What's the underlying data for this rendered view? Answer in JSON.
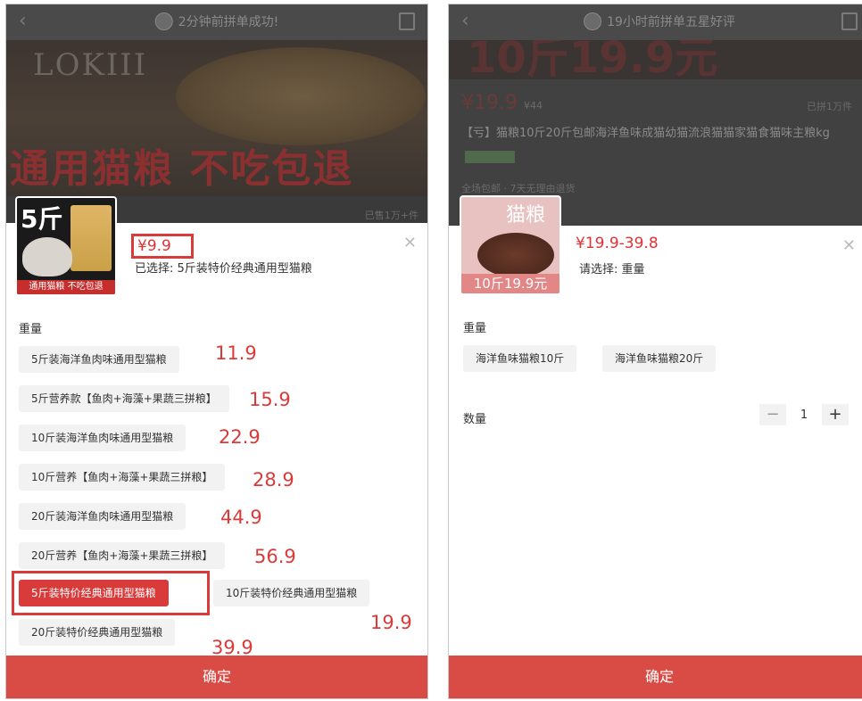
{
  "left": {
    "nav": {
      "back_icon": "‹",
      "notice": "2分钟前拼单成功!"
    },
    "banner": {
      "logo": "LOKIII",
      "slogan": "通用猫粮 不吃包退"
    },
    "sold_count": "已售1万+件",
    "thumb": {
      "size_text": "5斤",
      "ribbon": "通用猫粮 不吃包退"
    },
    "price": "¥9.9",
    "selected": "已选择: 5斤装特价经典通用型猫粮",
    "close_icon": "✕",
    "weight_label": "重量",
    "options": [
      {
        "label": "5斤装海洋鱼肉味通用型猫粮",
        "annot": "11.9"
      },
      {
        "label": "5斤营养款【鱼肉+海藻+果蔬三拼粮】",
        "annot": "15.9"
      },
      {
        "label": "10斤装海洋鱼肉味通用型猫粮",
        "annot": "22.9"
      },
      {
        "label": "10斤营养【鱼肉+海藻+果蔬三拼粮】",
        "annot": "28.9"
      },
      {
        "label": "20斤装海洋鱼肉味通用型猫粮",
        "annot": "44.9"
      },
      {
        "label": "20斤营养【鱼肉+海藻+果蔬三拼粮】",
        "annot": "56.9"
      },
      {
        "label": "5斤装特价经典通用型猫粮",
        "active": true
      },
      {
        "label": "10斤装特价经典通用型猫粮",
        "annot": "19.9"
      },
      {
        "label": "20斤装特价经典通用型猫粮",
        "annot": "39.9"
      }
    ],
    "confirm": "确定"
  },
  "right": {
    "nav": {
      "back_icon": "‹",
      "notice": "19小时前拼单五星好评"
    },
    "info": {
      "big_strip": "10斤19.9元",
      "price": "¥19.9",
      "price_old": "¥44",
      "ship": "已拼1万件",
      "title": "【亏】猫粮10斤20斤包邮海洋鱼味成猫幼猫流浪猫猫家猫食猫味主粮kg",
      "meta": "全场包邮 · 7天无理由退货"
    },
    "thumb": {
      "logo": "猫粮",
      "ribbon": "10斤19.9元"
    },
    "price": "¥19.9-39.8",
    "selected": "请选择: 重量",
    "close_icon": "✕",
    "weight_label": "重量",
    "options": [
      "海洋鱼味猫粮10斤",
      "海洋鱼味猫粮20斤"
    ],
    "qty_label": "数量",
    "qty": {
      "minus": "−",
      "value": "1",
      "plus": "+"
    },
    "confirm": "确定"
  }
}
